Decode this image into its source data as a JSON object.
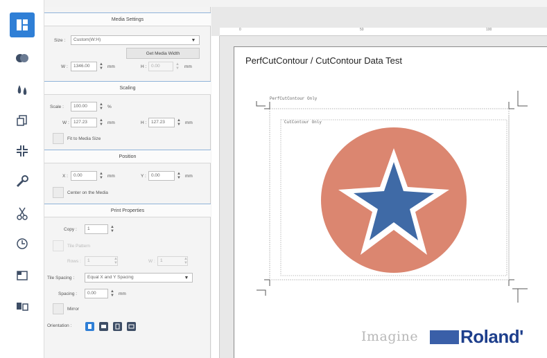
{
  "sidebar": {
    "icons": [
      {
        "name": "layout-icon",
        "active": true
      },
      {
        "name": "color-management-icon"
      },
      {
        "name": "paint-drops-icon"
      },
      {
        "name": "layers-icon"
      },
      {
        "name": "crop-marks-icon"
      },
      {
        "name": "wrench-icon"
      },
      {
        "name": "scissors-icon"
      },
      {
        "name": "clock-icon"
      },
      {
        "name": "printer-icon"
      },
      {
        "name": "copy-pages-icon"
      }
    ],
    "accent": "#2f7fd6"
  },
  "media_settings": {
    "header": "Media Settings",
    "size_label": "Size :",
    "size_value": "Custom(W:H)",
    "get_media_width_button": "Get Media Width",
    "w_label": "W :",
    "w_value": "1346.00",
    "w_unit": "mm",
    "h_label": "H :",
    "h_value": "0.00",
    "h_unit": "mm"
  },
  "scaling": {
    "header": "Scaling",
    "scale_label": "Scale :",
    "scale_value": "100.00",
    "scale_unit": "%",
    "w_label": "W :",
    "w_value": "127.23",
    "w_unit": "mm",
    "h_label": "H :",
    "h_value": "127.23",
    "h_unit": "mm",
    "fit_label": "Fit to Media Size"
  },
  "position": {
    "header": "Position",
    "x_label": "X :",
    "x_value": "0.00",
    "x_unit": "mm",
    "y_label": "Y :",
    "y_value": "0.00",
    "y_unit": "mm",
    "center_label": "Center on the Media"
  },
  "print_properties": {
    "header": "Print Properties",
    "copy_label": "Copy :",
    "copy_value": "1",
    "tile_label": "Tile Pattern",
    "rows_label": "Rows :",
    "rows_value": "1",
    "cols_label": "W :",
    "cols_value": "1",
    "tile_spacing_label": "Tile Spacing :",
    "tile_spacing_value": "Equal X and Y Spacing",
    "spacing_label": "Spacing :",
    "spacing_value": "0.00",
    "spacing_unit": "mm",
    "mirror_label": "Mirror",
    "orientation_label": "Orientation :"
  },
  "preview": {
    "ruler_numbers": [
      "0",
      "50",
      "100"
    ],
    "title": "PerfCutContour / CutContour Data Test",
    "perfcut_label": "PerfCutContour Only",
    "cutcontour_label": "CutContour Only",
    "circle_color": "#db8670",
    "star_color": "#3f6aa6",
    "logo_tagline": "Imagine",
    "logo_brand": "Roland'",
    "logo_color": "#1e3f8c"
  }
}
